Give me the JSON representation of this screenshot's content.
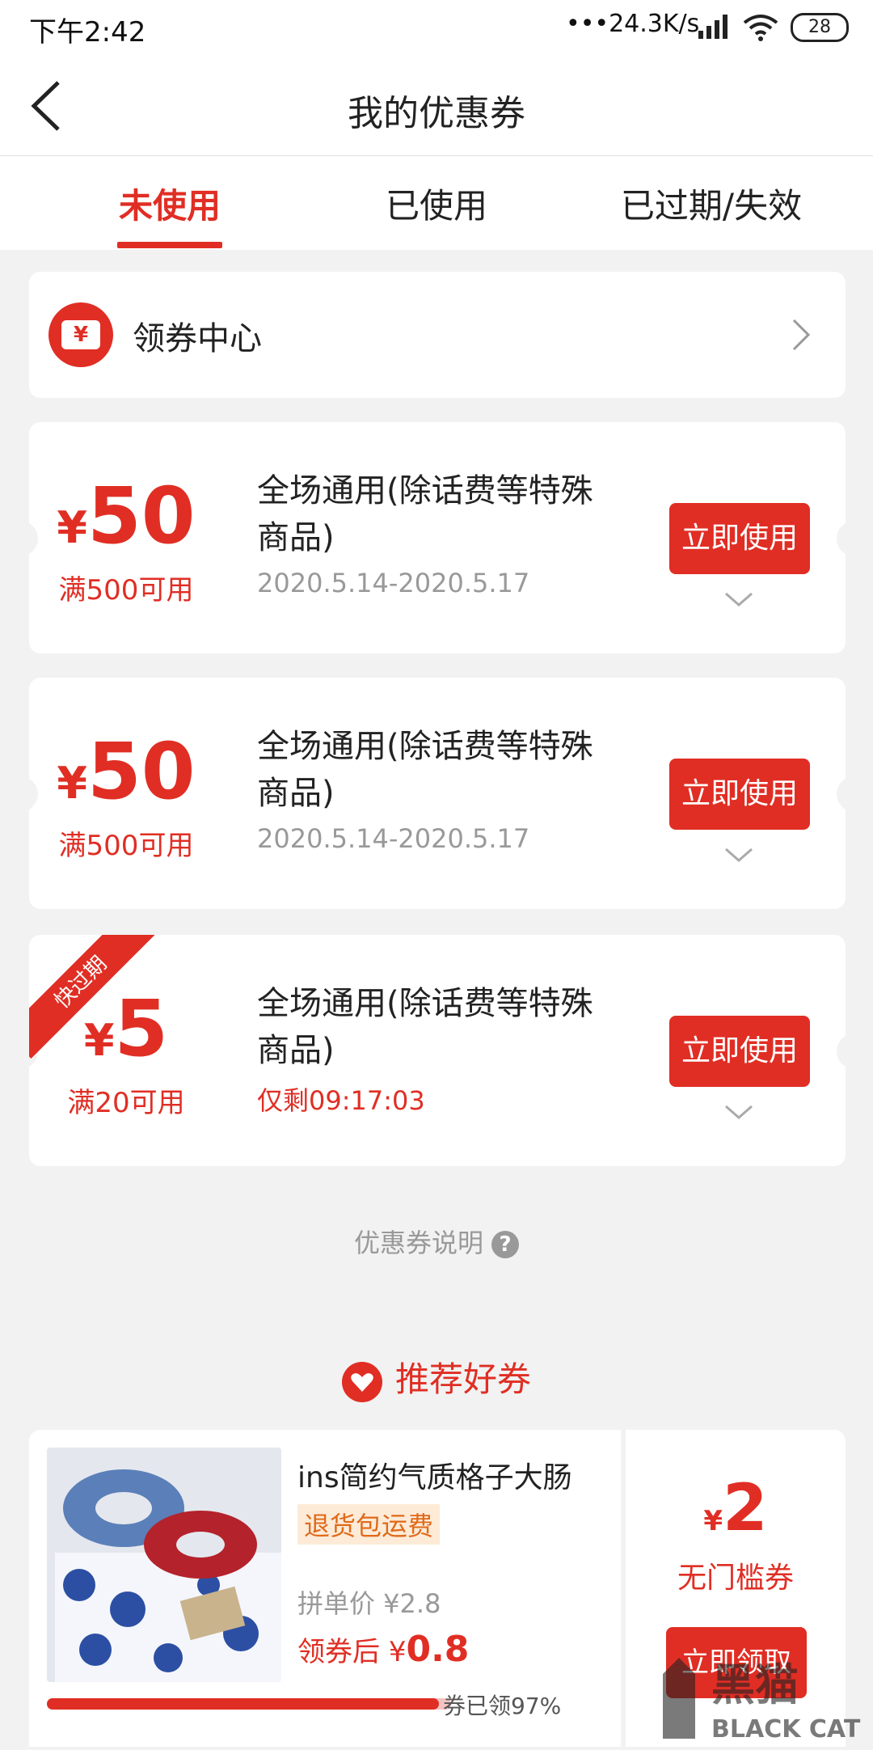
{
  "status_bar": {
    "time": "下午2:42",
    "network": "•••24.3K/s",
    "battery": "28"
  },
  "nav": {
    "title": "我的优惠券"
  },
  "tabs": [
    {
      "label": "未使用",
      "active": true
    },
    {
      "label": "已使用",
      "active": false
    },
    {
      "label": "已过期/失效",
      "active": false
    }
  ],
  "coupon_center": {
    "icon_glyph": "¥",
    "label": "领券中心"
  },
  "coupons": [
    {
      "currency": "¥",
      "amount": "50",
      "condition": "满500可用",
      "description": "全场通用(除话费等特殊商品)",
      "date": "2020.5.14-2020.5.17",
      "button": "立即使用"
    },
    {
      "currency": "¥",
      "amount": "50",
      "condition": "满500可用",
      "description": "全场通用(除话费等特殊商品)",
      "date": "2020.5.14-2020.5.17",
      "button": "立即使用"
    },
    {
      "currency": "¥",
      "amount": "5",
      "condition": "满20可用",
      "description": "全场通用(除话费等特殊商品)",
      "date": "仅剩09:17:03",
      "button": "立即使用",
      "ribbon": "快过期"
    }
  ],
  "help_text": "优惠券说明",
  "recommend": {
    "title": "推荐好券",
    "product": {
      "name": "ins简约气质格子大肠",
      "badge": "退货包运费",
      "price_label": "拼单价 ¥2.8",
      "after_prefix": "领券后",
      "after_currency": "¥",
      "after_value": "0.8",
      "progress_text": "券已领97%",
      "progress": 0.97
    },
    "coupon": {
      "currency": "¥",
      "amount": "2",
      "label": "无门槛券",
      "button": "立即领取"
    }
  },
  "watermark": {
    "cn": "黑猫",
    "en": "BLACK CAT"
  },
  "colors": {
    "accent": "#e02e24",
    "background": "#f2f2f2"
  }
}
